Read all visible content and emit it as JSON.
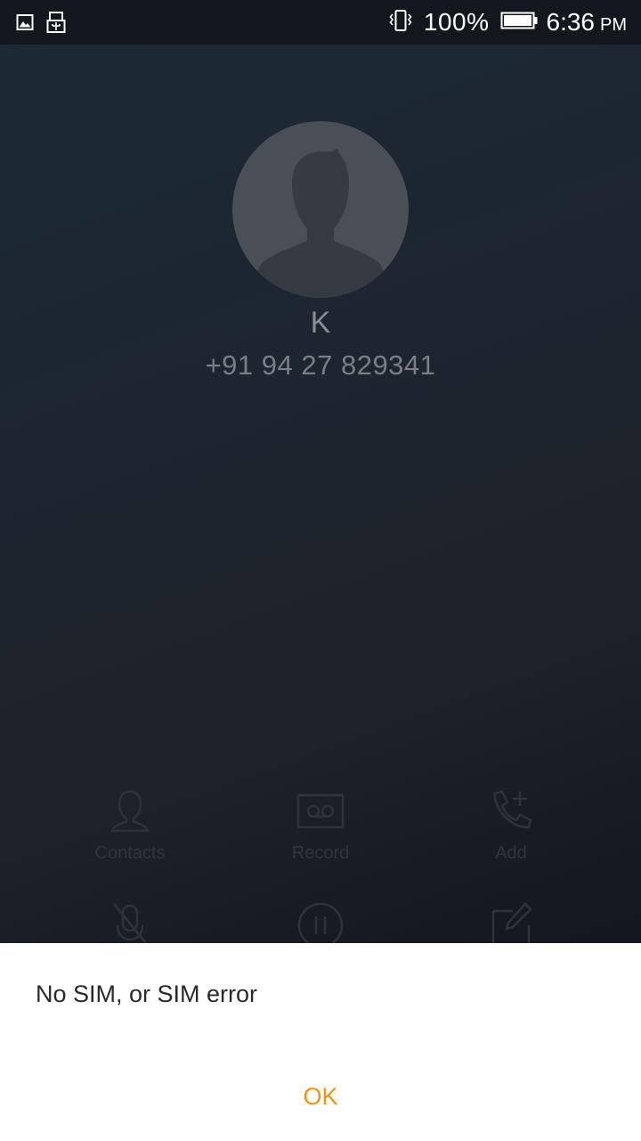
{
  "status_bar": {
    "left_icons": [
      "image-icon",
      "usb-icon"
    ],
    "right_icons": [
      "vibrate-icon",
      "battery-icon"
    ],
    "battery_percent": "100%",
    "time": "6:36",
    "ampm": "PM"
  },
  "caller": {
    "name": "K",
    "number": "+91 94 27 829341"
  },
  "actions": [
    {
      "label": "Contacts",
      "icon": "contacts-icon"
    },
    {
      "label": "Record",
      "icon": "record-icon"
    },
    {
      "label": "Add",
      "icon": "add-call-icon"
    },
    {
      "label": "",
      "icon": "mute-icon"
    },
    {
      "label": "",
      "icon": "hold-icon"
    },
    {
      "label": "",
      "icon": "note-icon"
    }
  ],
  "dialog": {
    "message": "No SIM, or SIM error",
    "ok_label": "OK"
  },
  "colors": {
    "accent": "#f39214",
    "status_bar": "#13181e",
    "background": "#1d2530"
  }
}
